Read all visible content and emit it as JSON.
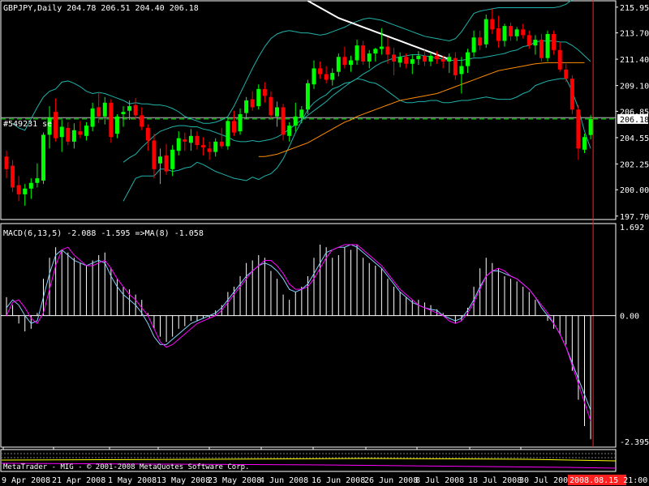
{
  "chart_data": {
    "type": "candlestick",
    "header": "GBPJPY,Daily  204.78 206.51 204.40 206.18",
    "symbol": "GBPJPY",
    "timeframe": "Daily",
    "last_ohlc": {
      "open": 204.78,
      "high": 206.51,
      "low": 204.4,
      "close": 206.18
    },
    "current_price_label": "206.18",
    "hline_label": "#549231 se",
    "hline_value": 206.3,
    "cursor_date_label": "2008.08.15 21:00",
    "colors": {
      "up": "#00ff00",
      "down": "#ff0000",
      "bollinger": "#20b2aa",
      "ma_slow": "#ff8c00",
      "ma_long": "#ffffff",
      "macd_line": "#87cefa",
      "signal_line": "#ff00ff",
      "grid_dash": "#00ff00",
      "cursor": "#ff2020"
    },
    "price_axis": {
      "ticks": [
        "215.95",
        "213.70",
        "211.40",
        "209.10",
        "206.85",
        "204.55",
        "202.25",
        "200.00",
        "197.70"
      ],
      "ylim": [
        197.4,
        216.5
      ]
    },
    "x_labels": [
      "9 Apr 2008",
      "21 Apr 2008",
      "1 May 2008",
      "13 May 2008",
      "23 May 2008",
      "4 Jun 2008",
      "16 Jun 2008",
      "26 Jun 2008",
      "8 Jul 2008",
      "18 Jul 2008",
      "30 Jul 2008"
    ],
    "candles": [
      {
        "o": 202.9,
        "h": 203.4,
        "l": 201.0,
        "c": 201.8
      },
      {
        "o": 202.1,
        "h": 202.6,
        "l": 199.8,
        "c": 200.2
      },
      {
        "o": 200.4,
        "h": 201.2,
        "l": 199.0,
        "c": 199.6
      },
      {
        "o": 199.6,
        "h": 200.5,
        "l": 198.6,
        "c": 200.1
      },
      {
        "o": 200.1,
        "h": 201.0,
        "l": 199.2,
        "c": 200.6
      },
      {
        "o": 200.6,
        "h": 202.3,
        "l": 200.2,
        "c": 201.0
      },
      {
        "o": 200.8,
        "h": 205.0,
        "l": 200.5,
        "c": 204.8
      },
      {
        "o": 204.8,
        "h": 207.3,
        "l": 203.6,
        "c": 206.3
      },
      {
        "o": 206.8,
        "h": 208.0,
        "l": 204.2,
        "c": 204.5
      },
      {
        "o": 204.6,
        "h": 206.1,
        "l": 203.3,
        "c": 205.5
      },
      {
        "o": 205.4,
        "h": 205.9,
        "l": 203.9,
        "c": 204.2
      },
      {
        "o": 204.2,
        "h": 205.8,
        "l": 203.6,
        "c": 205.2
      },
      {
        "o": 205.1,
        "h": 206.0,
        "l": 204.5,
        "c": 204.8
      },
      {
        "o": 204.7,
        "h": 205.9,
        "l": 204.3,
        "c": 205.6
      },
      {
        "o": 205.5,
        "h": 207.6,
        "l": 205.1,
        "c": 207.1
      },
      {
        "o": 207.2,
        "h": 208.5,
        "l": 205.8,
        "c": 206.4
      },
      {
        "o": 206.4,
        "h": 208.1,
        "l": 205.7,
        "c": 207.6
      },
      {
        "o": 207.6,
        "h": 207.9,
        "l": 204.1,
        "c": 204.6
      },
      {
        "o": 204.9,
        "h": 206.6,
        "l": 204.5,
        "c": 206.4
      },
      {
        "o": 206.6,
        "h": 207.3,
        "l": 205.5,
        "c": 206.8
      },
      {
        "o": 206.9,
        "h": 207.8,
        "l": 206.1,
        "c": 207.3
      },
      {
        "o": 207.4,
        "h": 208.0,
        "l": 206.1,
        "c": 206.5
      },
      {
        "o": 206.5,
        "h": 207.2,
        "l": 205.2,
        "c": 205.5
      },
      {
        "o": 205.4,
        "h": 205.7,
        "l": 203.4,
        "c": 204.3
      },
      {
        "o": 204.3,
        "h": 204.9,
        "l": 201.0,
        "c": 201.8
      },
      {
        "o": 202.3,
        "h": 203.6,
        "l": 200.5,
        "c": 202.9
      },
      {
        "o": 203.0,
        "h": 204.0,
        "l": 201.3,
        "c": 201.6
      },
      {
        "o": 201.8,
        "h": 203.9,
        "l": 201.2,
        "c": 203.5
      },
      {
        "o": 203.4,
        "h": 205.1,
        "l": 203.0,
        "c": 204.5
      },
      {
        "o": 204.4,
        "h": 205.0,
        "l": 203.4,
        "c": 204.2
      },
      {
        "o": 204.1,
        "h": 205.3,
        "l": 203.4,
        "c": 204.7
      },
      {
        "o": 204.7,
        "h": 205.1,
        "l": 203.5,
        "c": 203.9
      },
      {
        "o": 203.9,
        "h": 204.6,
        "l": 203.0,
        "c": 203.7
      },
      {
        "o": 203.6,
        "h": 204.2,
        "l": 202.6,
        "c": 203.3
      },
      {
        "o": 203.3,
        "h": 204.5,
        "l": 202.9,
        "c": 204.2
      },
      {
        "o": 204.2,
        "h": 205.4,
        "l": 203.6,
        "c": 203.8
      },
      {
        "o": 203.8,
        "h": 206.3,
        "l": 203.5,
        "c": 206.0
      },
      {
        "o": 206.0,
        "h": 206.9,
        "l": 204.7,
        "c": 205.0
      },
      {
        "o": 205.1,
        "h": 207.1,
        "l": 204.8,
        "c": 206.6
      },
      {
        "o": 206.7,
        "h": 208.1,
        "l": 206.2,
        "c": 207.8
      },
      {
        "o": 207.9,
        "h": 208.6,
        "l": 206.9,
        "c": 207.2
      },
      {
        "o": 207.3,
        "h": 209.2,
        "l": 207.0,
        "c": 208.8
      },
      {
        "o": 208.8,
        "h": 209.4,
        "l": 207.6,
        "c": 208.2
      },
      {
        "o": 208.1,
        "h": 208.6,
        "l": 206.2,
        "c": 206.5
      },
      {
        "o": 206.4,
        "h": 207.7,
        "l": 205.5,
        "c": 207.2
      },
      {
        "o": 207.2,
        "h": 207.5,
        "l": 204.3,
        "c": 204.8
      },
      {
        "o": 204.7,
        "h": 205.9,
        "l": 204.2,
        "c": 205.6
      },
      {
        "o": 205.6,
        "h": 207.6,
        "l": 205.1,
        "c": 206.4
      },
      {
        "o": 206.3,
        "h": 207.3,
        "l": 205.8,
        "c": 207.0
      },
      {
        "o": 207.0,
        "h": 209.6,
        "l": 206.6,
        "c": 209.3
      },
      {
        "o": 209.2,
        "h": 211.3,
        "l": 208.8,
        "c": 210.6
      },
      {
        "o": 210.6,
        "h": 211.2,
        "l": 209.7,
        "c": 210.1
      },
      {
        "o": 210.1,
        "h": 210.8,
        "l": 209.3,
        "c": 209.6
      },
      {
        "o": 209.6,
        "h": 210.6,
        "l": 209.1,
        "c": 210.2
      },
      {
        "o": 210.3,
        "h": 211.9,
        "l": 209.9,
        "c": 211.6
      },
      {
        "o": 211.6,
        "h": 212.5,
        "l": 210.6,
        "c": 210.9
      },
      {
        "o": 210.9,
        "h": 211.7,
        "l": 210.3,
        "c": 211.3
      },
      {
        "o": 211.3,
        "h": 213.1,
        "l": 210.9,
        "c": 212.6
      },
      {
        "o": 212.6,
        "h": 213.0,
        "l": 210.9,
        "c": 211.2
      },
      {
        "o": 211.2,
        "h": 212.2,
        "l": 210.6,
        "c": 211.9
      },
      {
        "o": 211.9,
        "h": 212.4,
        "l": 211.2,
        "c": 212.3
      },
      {
        "o": 212.3,
        "h": 214.1,
        "l": 211.8,
        "c": 212.5
      },
      {
        "o": 212.5,
        "h": 213.3,
        "l": 211.0,
        "c": 211.8
      },
      {
        "o": 211.8,
        "h": 212.4,
        "l": 210.0,
        "c": 211.2
      },
      {
        "o": 211.1,
        "h": 212.0,
        "l": 210.7,
        "c": 211.6
      },
      {
        "o": 211.6,
        "h": 211.9,
        "l": 210.6,
        "c": 211.0
      },
      {
        "o": 211.0,
        "h": 211.8,
        "l": 210.1,
        "c": 211.4
      },
      {
        "o": 211.4,
        "h": 212.1,
        "l": 210.9,
        "c": 211.7
      },
      {
        "o": 211.7,
        "h": 212.2,
        "l": 210.8,
        "c": 211.2
      },
      {
        "o": 211.2,
        "h": 212.0,
        "l": 210.8,
        "c": 211.7
      },
      {
        "o": 211.7,
        "h": 212.1,
        "l": 211.0,
        "c": 211.4
      },
      {
        "o": 211.4,
        "h": 211.7,
        "l": 210.6,
        "c": 211.2
      },
      {
        "o": 211.2,
        "h": 211.9,
        "l": 210.2,
        "c": 211.6
      },
      {
        "o": 211.5,
        "h": 212.0,
        "l": 209.6,
        "c": 210.0
      },
      {
        "o": 210.1,
        "h": 211.6,
        "l": 208.4,
        "c": 210.8
      },
      {
        "o": 210.8,
        "h": 212.3,
        "l": 210.2,
        "c": 212.0
      },
      {
        "o": 212.0,
        "h": 213.9,
        "l": 211.6,
        "c": 213.3
      },
      {
        "o": 213.3,
        "h": 213.9,
        "l": 212.2,
        "c": 212.6
      },
      {
        "o": 212.7,
        "h": 215.3,
        "l": 212.4,
        "c": 214.9
      },
      {
        "o": 214.9,
        "h": 215.8,
        "l": 213.6,
        "c": 214.0
      },
      {
        "o": 214.1,
        "h": 215.2,
        "l": 212.4,
        "c": 213.0
      },
      {
        "o": 213.0,
        "h": 214.5,
        "l": 212.5,
        "c": 214.3
      },
      {
        "o": 214.3,
        "h": 214.6,
        "l": 213.0,
        "c": 213.4
      },
      {
        "o": 213.4,
        "h": 214.2,
        "l": 213.0,
        "c": 214.0
      },
      {
        "o": 214.0,
        "h": 214.5,
        "l": 213.2,
        "c": 213.5
      },
      {
        "o": 213.5,
        "h": 213.9,
        "l": 212.3,
        "c": 212.6
      },
      {
        "o": 212.6,
        "h": 213.5,
        "l": 211.8,
        "c": 213.1
      },
      {
        "o": 213.1,
        "h": 213.6,
        "l": 211.2,
        "c": 211.5
      },
      {
        "o": 211.5,
        "h": 213.9,
        "l": 211.2,
        "c": 213.6
      },
      {
        "o": 213.6,
        "h": 213.9,
        "l": 211.8,
        "c": 212.2
      },
      {
        "o": 212.2,
        "h": 212.9,
        "l": 210.3,
        "c": 210.5
      },
      {
        "o": 210.5,
        "h": 211.0,
        "l": 209.4,
        "c": 209.7
      },
      {
        "o": 209.7,
        "h": 210.0,
        "l": 206.6,
        "c": 207.0
      },
      {
        "o": 207.0,
        "h": 207.4,
        "l": 202.6,
        "c": 203.6
      },
      {
        "o": 203.5,
        "h": 204.9,
        "l": 203.2,
        "c": 204.6
      },
      {
        "o": 204.78,
        "h": 206.51,
        "l": 204.4,
        "c": 206.18
      }
    ],
    "bollinger": {
      "upper": [
        205.8,
        205.4,
        205.2,
        206.2,
        207.2,
        208.1,
        208.6,
        208.8,
        209.4,
        209.5,
        209.3,
        209.0,
        208.6,
        208.4,
        208.5,
        208.4,
        208.2,
        208.0,
        207.8,
        207.5,
        207.6,
        207.5,
        207.5,
        207.4,
        207.4,
        207.3,
        207.1,
        206.8,
        206.4,
        206.2,
        206.0,
        205.8,
        205.8,
        205.9,
        206.1,
        206.4,
        207.3,
        208.4,
        209.5,
        210.6,
        211.6,
        212.5,
        213.2,
        213.6,
        213.8,
        213.9,
        213.8,
        213.7,
        213.7,
        213.6,
        213.5,
        213.6,
        213.8,
        214.0,
        214.2,
        214.5,
        214.7,
        214.9,
        215.0,
        214.9,
        214.8,
        214.6,
        214.4,
        214.2,
        214.0,
        213.8,
        213.6,
        213.4,
        213.3,
        213.2,
        213.1,
        213.0,
        213.2,
        213.8,
        214.6,
        215.4,
        215.6,
        215.7,
        215.8,
        215.9,
        215.9,
        215.9,
        215.9,
        215.9,
        215.9,
        215.9,
        215.9,
        215.9,
        215.9,
        216.0,
        216.2,
        216.6,
        217.0,
        217.5,
        217.8
      ],
      "middle": [
        202.4,
        202.8,
        203.1,
        203.7,
        204.2,
        204.7,
        205.1,
        205.3,
        205.5,
        205.6,
        205.6,
        205.5,
        205.5,
        205.3,
        205.2,
        205.0,
        204.8,
        204.6,
        204.3,
        204.2,
        204.2,
        204.3,
        204.2,
        204.3,
        204.4,
        204.6,
        204.9,
        205.3,
        205.7,
        206.1,
        206.5,
        206.9,
        207.3,
        207.7,
        208.2,
        208.6,
        209.0,
        209.4,
        209.7,
        210.1,
        210.4,
        210.8,
        211.1,
        211.3,
        211.5,
        211.6,
        211.7,
        211.8,
        211.8,
        211.7,
        211.6,
        211.5,
        211.4,
        211.3,
        211.3,
        211.3,
        211.4,
        211.5,
        211.5,
        211.6,
        211.7,
        211.8,
        211.9,
        212.1,
        212.2,
        212.5,
        212.6,
        212.9,
        213.0,
        213.0,
        213.0,
        212.9,
        212.9,
        212.6,
        212.2,
        211.7,
        211.2
      ],
      "lower": [
        199.0,
        200.0,
        201.0,
        201.2,
        201.2,
        201.2,
        201.8,
        201.8,
        201.6,
        201.7,
        201.9,
        202.0,
        202.4,
        202.2,
        201.9,
        201.6,
        201.4,
        201.2,
        201.0,
        200.9,
        200.8,
        201.1,
        200.9,
        201.2,
        201.4,
        201.9,
        202.7,
        203.8,
        205.0,
        206.0,
        207.0,
        207.6,
        208.0,
        208.3,
        208.8,
        209.0,
        209.3,
        209.4,
        209.7,
        209.6,
        209.4,
        209.3,
        209.0,
        208.6,
        208.2,
        207.8,
        207.6,
        207.6,
        207.7,
        207.7,
        207.8,
        207.8,
        207.6,
        207.6,
        207.7,
        207.8,
        207.8,
        207.9,
        208.0,
        208.1,
        208.0,
        207.9,
        207.9,
        207.9,
        208.1,
        208.4,
        208.6,
        209.1,
        209.3,
        209.5,
        209.6,
        209.7,
        209.7,
        208.6,
        207.1,
        205.1,
        203.6
      ],
      "start_index": 0
    },
    "ma_slow": {
      "start_index": 41,
      "values": [
        202.9,
        202.9,
        203.0,
        203.1,
        203.3,
        203.5,
        203.7,
        203.9,
        204.1,
        204.4,
        204.7,
        205.0,
        205.3,
        205.6,
        205.9,
        206.1,
        206.4,
        206.6,
        206.8,
        207.0,
        207.2,
        207.4,
        207.6,
        207.8,
        207.9,
        208.0,
        208.1,
        208.2,
        208.3,
        208.4,
        208.6,
        208.8,
        209.0,
        209.2,
        209.4,
        209.6,
        209.8,
        210.0,
        210.2,
        210.4,
        210.5,
        210.6,
        210.7,
        210.8,
        210.9,
        211.0,
        211.05,
        211.1,
        211.1,
        211.1,
        211.1,
        211.1,
        211.1,
        211.1
      ]
    },
    "ma_long": {
      "start_index": 62,
      "values": [
        216.5,
        216.2,
        215.9,
        215.6,
        215.3,
        215.0,
        214.8,
        214.6,
        214.4,
        214.2,
        214.0,
        213.8,
        213.6,
        213.4,
        213.2,
        213.0,
        212.8,
        212.6,
        212.4,
        212.2,
        212.0,
        211.8,
        211.6,
        211.4
      ]
    },
    "macd": {
      "label": "MACD(6,13,5) -2.088 -1.595  =>MA(8) -1.058",
      "axis_ticks": [
        "1.692",
        "0.00",
        "-2.395"
      ],
      "ylim": [
        -2.5,
        1.75
      ],
      "hist": [
        0.35,
        0.2,
        -0.15,
        -0.3,
        -0.25,
        0.05,
        0.7,
        1.1,
        1.3,
        1.25,
        1.2,
        1.1,
        1.0,
        0.95,
        1.05,
        1.15,
        1.2,
        0.9,
        0.7,
        0.55,
        0.5,
        0.4,
        0.3,
        0.05,
        -0.25,
        -0.4,
        -0.5,
        -0.4,
        -0.25,
        -0.2,
        -0.1,
        -0.1,
        -0.05,
        -0.05,
        0.1,
        0.2,
        0.45,
        0.55,
        0.75,
        1.0,
        1.05,
        1.15,
        1.1,
        0.85,
        0.7,
        0.4,
        0.3,
        0.45,
        0.55,
        0.75,
        1.1,
        1.35,
        1.3,
        1.1,
        1.15,
        1.3,
        1.25,
        1.35,
        1.1,
        1.0,
        0.95,
        0.9,
        0.7,
        0.55,
        0.45,
        0.35,
        0.3,
        0.3,
        0.25,
        0.2,
        0.12,
        0.05,
        0.0,
        -0.15,
        -0.1,
        0.15,
        0.55,
        0.9,
        1.1,
        1.0,
        0.9,
        0.75,
        0.7,
        0.65,
        0.55,
        0.45,
        0.3,
        0.0,
        -0.1,
        -0.25,
        -0.35,
        -0.55,
        -1.05,
        -1.6,
        -2.1,
        -2.35
      ],
      "macd_line": [
        0.15,
        0.3,
        0.2,
        0.0,
        -0.15,
        -0.1,
        0.35,
        0.8,
        1.15,
        1.25,
        1.15,
        1.05,
        1.0,
        0.95,
        1.0,
        1.05,
        1.0,
        0.75,
        0.55,
        0.4,
        0.3,
        0.2,
        0.05,
        -0.15,
        -0.4,
        -0.55,
        -0.55,
        -0.45,
        -0.35,
        -0.25,
        -0.15,
        -0.1,
        -0.05,
        0.0,
        0.05,
        0.15,
        0.3,
        0.45,
        0.6,
        0.75,
        0.85,
        0.95,
        1.0,
        0.95,
        0.85,
        0.7,
        0.5,
        0.45,
        0.5,
        0.6,
        0.8,
        1.0,
        1.2,
        1.25,
        1.3,
        1.3,
        1.35,
        1.3,
        1.2,
        1.1,
        1.0,
        0.9,
        0.75,
        0.6,
        0.45,
        0.35,
        0.25,
        0.2,
        0.15,
        0.12,
        0.1,
        0.0,
        -0.05,
        -0.1,
        -0.05,
        0.1,
        0.3,
        0.55,
        0.75,
        0.85,
        0.85,
        0.8,
        0.75,
        0.7,
        0.6,
        0.5,
        0.35,
        0.15,
        0.0,
        -0.15,
        -0.35,
        -0.6,
        -0.9,
        -1.2,
        -1.5,
        -1.8
      ],
      "signal_line": [
        0.0,
        0.25,
        0.3,
        0.15,
        -0.05,
        -0.15,
        0.05,
        0.5,
        0.95,
        1.25,
        1.3,
        1.15,
        1.05,
        0.95,
        0.95,
        1.0,
        1.05,
        0.9,
        0.7,
        0.55,
        0.4,
        0.3,
        0.15,
        0.0,
        -0.25,
        -0.5,
        -0.6,
        -0.55,
        -0.45,
        -0.35,
        -0.25,
        -0.15,
        -0.1,
        -0.05,
        0.0,
        0.1,
        0.25,
        0.4,
        0.55,
        0.7,
        0.85,
        0.95,
        1.05,
        1.05,
        0.95,
        0.8,
        0.6,
        0.5,
        0.5,
        0.55,
        0.7,
        0.9,
        1.1,
        1.25,
        1.3,
        1.35,
        1.35,
        1.35,
        1.25,
        1.15,
        1.05,
        0.95,
        0.8,
        0.65,
        0.5,
        0.4,
        0.3,
        0.2,
        0.15,
        0.1,
        0.05,
        0.0,
        -0.1,
        -0.15,
        -0.1,
        0.05,
        0.25,
        0.5,
        0.75,
        0.85,
        0.9,
        0.85,
        0.75,
        0.7,
        0.6,
        0.5,
        0.35,
        0.2,
        0.05,
        -0.15,
        -0.35,
        -0.6,
        -0.95,
        -1.3,
        -1.65,
        -2.0
      ]
    },
    "footer_text": "MetaTrader - MIG - © 2001-2008 MetaQuotes Software Corp."
  }
}
